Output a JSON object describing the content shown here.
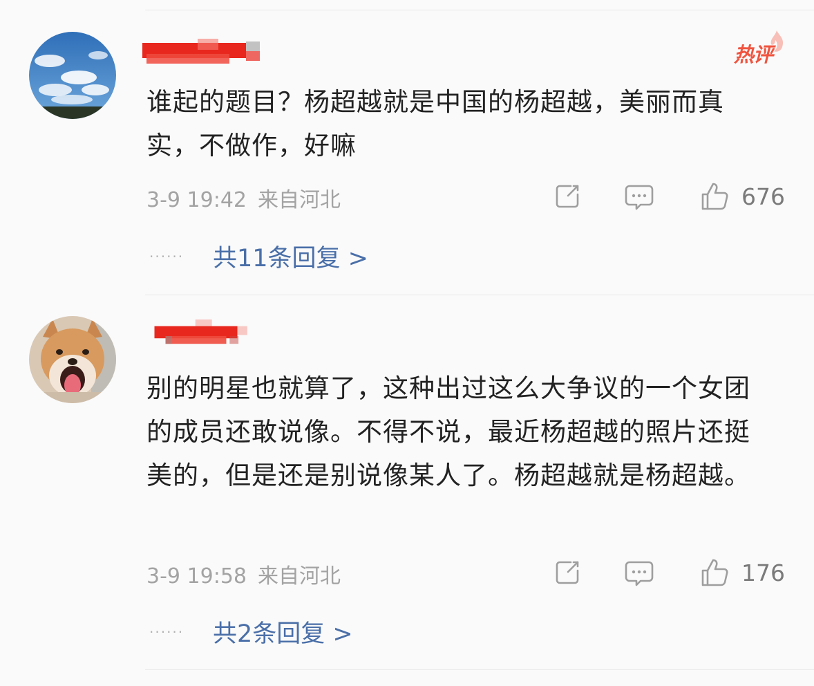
{
  "comments": [
    {
      "text": "谁起的题目？杨超越就是中国的杨超越，美丽而真实，不做作，好嘛",
      "time": "3-9 19:42",
      "location": "来自河北",
      "likes": "676",
      "replies_label": "共11条回复 >",
      "dots": "······",
      "badge": "热评",
      "avatar_icon": "sky-clouds-avatar"
    },
    {
      "text": "别的明星也就算了，这种出过这么大争议的一个女团的成员还敢说像。不得不说，最近杨超越的照片还挺美的，但是还是别说像某人了。杨超越就是杨超越。",
      "time": "3-9 19:58",
      "location": "来自河北",
      "likes": "176",
      "replies_label": "共2条回复 >",
      "dots": "······",
      "avatar_icon": "shiba-dog-avatar"
    }
  ],
  "colors": {
    "background": "#fafafa",
    "text": "#222222",
    "meta": "#a3a3a3",
    "link": "#4a6fa8",
    "hot": "#f0543f",
    "redaction": "#e8281e"
  },
  "icons": [
    "share-icon",
    "comment-icon",
    "like-icon",
    "hot-flame-icon"
  ]
}
